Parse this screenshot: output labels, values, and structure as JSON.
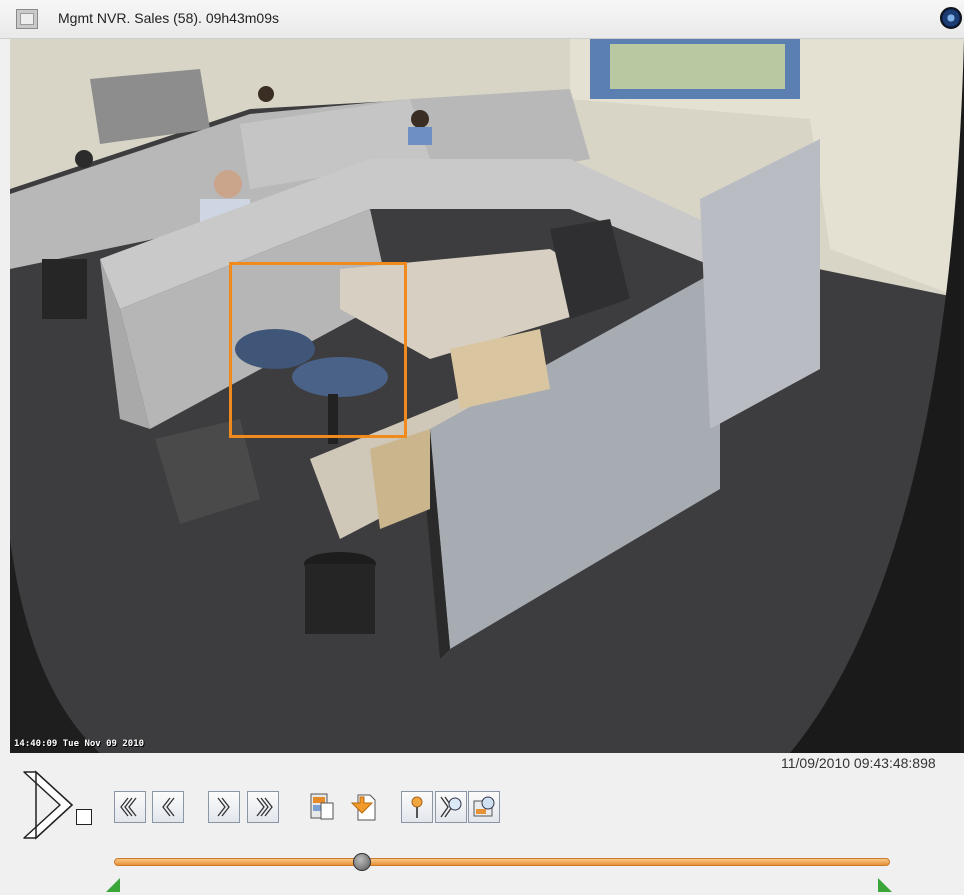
{
  "window": {
    "title": "Mgmt NVR. Sales (58). 09h43m09s"
  },
  "video": {
    "overlay_text": "14:40:09 Tue Nov 09 2010",
    "selection_color": "#f08a1c"
  },
  "playback": {
    "timestamp": "11/09/2010 09:43:48:898",
    "position_fraction": 0.32
  },
  "toolbar": {
    "buttons": [
      {
        "icon": "play-icon"
      },
      {
        "icon": "stop-icon"
      },
      {
        "icon": "fast-rewind-icon"
      },
      {
        "icon": "step-back-icon"
      },
      {
        "icon": "step-forward-icon"
      },
      {
        "icon": "fast-forward-icon"
      },
      {
        "icon": "export-clip-icon"
      },
      {
        "icon": "download-icon"
      },
      {
        "icon": "bookmark-icon"
      },
      {
        "icon": "search-forward-icon"
      },
      {
        "icon": "snapshot-icon"
      }
    ]
  },
  "colors": {
    "slider_track": "#e79236",
    "marker": "#3aa63a"
  }
}
